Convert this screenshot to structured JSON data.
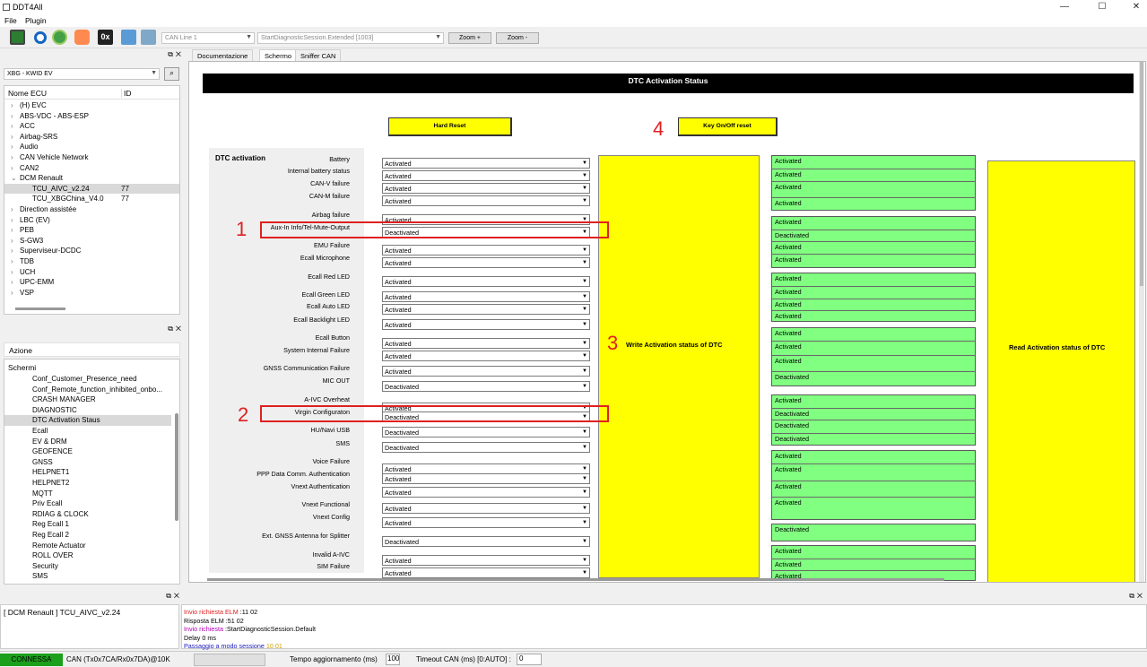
{
  "window": {
    "title": "DDT4All",
    "min": "—",
    "max": "☐",
    "close": "✕"
  },
  "menu": [
    "File",
    "Plugin"
  ],
  "toolbar": {
    "can_line": "CAN Line 1",
    "session": "StartDiagnosticSession.Extended [1003]",
    "zoom_in": "Zoom +",
    "zoom_out": "Zoom -",
    "hex_label": "0x"
  },
  "vehicle": {
    "selected": "XBG - KWID EV",
    "search_icon": "search-icon"
  },
  "ecu_tree": {
    "col_name": "Nome ECU",
    "col_id": "ID",
    "items": [
      {
        "label": "(H) EVC",
        "id": "",
        "level": 0,
        "exp": ">"
      },
      {
        "label": "ABS-VDC - ABS-ESP",
        "id": "",
        "level": 0,
        "exp": ">"
      },
      {
        "label": "ACC",
        "id": "",
        "level": 0,
        "exp": ">"
      },
      {
        "label": "Airbag-SRS",
        "id": "",
        "level": 0,
        "exp": ">"
      },
      {
        "label": "Audio",
        "id": "",
        "level": 0,
        "exp": ">"
      },
      {
        "label": "CAN Vehicle Network",
        "id": "",
        "level": 0,
        "exp": ">"
      },
      {
        "label": "CAN2",
        "id": "",
        "level": 0,
        "exp": ">"
      },
      {
        "label": "DCM Renault",
        "id": "",
        "level": 0,
        "exp": "v"
      },
      {
        "label": "TCU_AIVC_v2.24",
        "id": "77",
        "level": 1,
        "exp": "",
        "selected": true
      },
      {
        "label": "TCU_XBGChina_V4.0",
        "id": "77",
        "level": 1,
        "exp": ""
      },
      {
        "label": "Direction assistée",
        "id": "",
        "level": 0,
        "exp": ">"
      },
      {
        "label": "LBC (EV)",
        "id": "",
        "level": 0,
        "exp": ">"
      },
      {
        "label": "PEB",
        "id": "",
        "level": 0,
        "exp": ">"
      },
      {
        "label": "S-GW3",
        "id": "",
        "level": 0,
        "exp": ">"
      },
      {
        "label": "Superviseur-DCDC",
        "id": "",
        "level": 0,
        "exp": ">"
      },
      {
        "label": "TDB",
        "id": "",
        "level": 0,
        "exp": ">"
      },
      {
        "label": "UCH",
        "id": "",
        "level": 0,
        "exp": ">"
      },
      {
        "label": "UPC-EMM",
        "id": "",
        "level": 0,
        "exp": ">"
      },
      {
        "label": "VSP",
        "id": "",
        "level": 0,
        "exp": ">"
      }
    ]
  },
  "actions": {
    "title": "Azione"
  },
  "screens": {
    "header": "Schermi",
    "items": [
      "Conf_Customer_Presence_need",
      "Conf_Remote_function_inhibited_onbo...",
      "CRASH MANAGER",
      "DIAGNOSTIC",
      "DTC Activation Staus",
      "Ecall",
      "EV & DRM",
      "GEOFENCE",
      "GNSS",
      "HELPNET1",
      "HELPNET2",
      "MQTT",
      "Priv Ecall",
      "RDIAG & CLOCK",
      "Reg Ecall 1",
      "Reg Ecall 2",
      "Remote Actuator",
      "ROLL OVER",
      "Security",
      "SMS"
    ],
    "selected_index": 4
  },
  "tabs": [
    "Documentazione",
    "Schermo",
    "Sniffer CAN"
  ],
  "screen": {
    "title": "DTC Activation Status",
    "hard_reset": "Hard Reset",
    "key_reset": "Key On/Off reset",
    "section": "DTC activation",
    "write_label": "Write Activation status of DTC",
    "read_label": "Read Activation status of DTC",
    "rows": [
      {
        "label": "Battery",
        "value": "Activated"
      },
      {
        "label": "Internal battery status",
        "value": "Activated"
      },
      {
        "label": "CAN-V failure",
        "value": "Activated"
      },
      {
        "label": "CAN-M failure",
        "value": "Activated"
      },
      {
        "label": "Airbag failure",
        "value": "Activated"
      },
      {
        "label": "Aux-In Info/Tel-Mute-Output",
        "value": "Deactivated"
      },
      {
        "label": "EMU Failure",
        "value": "Activated"
      },
      {
        "label": "Ecall Microphone",
        "value": "Activated"
      },
      {
        "label": "Ecall Red LED",
        "value": "Activated"
      },
      {
        "label": "Ecall Green LED",
        "value": "Activated"
      },
      {
        "label": "Ecall Auto LED",
        "value": "Activated"
      },
      {
        "label": "Ecall Backlight  LED",
        "value": "Activated"
      },
      {
        "label": "Ecall Button",
        "value": "Activated"
      },
      {
        "label": "System Internal Failure",
        "value": "Activated"
      },
      {
        "label": "GNSS Communication Failure",
        "value": "Activated"
      },
      {
        "label": "MIC OUT",
        "value": "Deactivated"
      },
      {
        "label": "A-IVC Overheat",
        "value": "Activated"
      },
      {
        "label": "Virgin Configuraton",
        "value": "Deactivated"
      },
      {
        "label": "HU/Navi USB",
        "value": "Deactivated"
      },
      {
        "label": "SMS",
        "value": "Deactivated"
      },
      {
        "label": "Voice Failure",
        "value": "Activated"
      },
      {
        "label": "PPP Data Comm. Authentication",
        "value": "Activated"
      },
      {
        "label": "Vnext Authentication",
        "value": "Activated"
      },
      {
        "label": "Vnext Functional",
        "value": "Activated"
      },
      {
        "label": "Vnext Config",
        "value": "Activated"
      },
      {
        "label": "Ext. GNSS Antenna for Splitter",
        "value": "Deactivated"
      },
      {
        "label": "Invalid A-IVC",
        "value": "Activated"
      },
      {
        "label": "SIM Failure",
        "value": "Activated"
      }
    ],
    "read_values": [
      [
        "Activated",
        "Activated",
        "Activated",
        "Activated"
      ],
      [
        "Activated",
        "Deactivated",
        "Activated",
        "Activated"
      ],
      [
        "Activated",
        "Activated",
        "Activated",
        "Activated"
      ],
      [
        "Activated",
        "Activated",
        "Activated",
        "Deactivated"
      ],
      [
        "Activated",
        "Deactivated",
        "Deactivated",
        "Deactivated"
      ],
      [
        "Activated",
        "Activated",
        "Activated",
        "Activated"
      ],
      [
        "Deactivated"
      ],
      [
        "Activated",
        "Activated",
        "Activated"
      ]
    ],
    "annotations": [
      "1",
      "2",
      "3",
      "4"
    ]
  },
  "log": {
    "ecu_label": "[ DCM Renault ] TCU_AIVC_v2.24",
    "lines": [
      {
        "k": "Invio richiesta ELM",
        "v": "11 02",
        "kc": "#e02020"
      },
      {
        "k": "Risposta ELM",
        "v": "51 02",
        "kc": "#000"
      },
      {
        "k": "Invio richiesta",
        "v": "StartDiagnosticSession.Default",
        "kc": "#b000b0"
      },
      {
        "k": "Delay 0 ms",
        "v": "",
        "kc": "#000"
      },
      {
        "k": "Passaggio a modo sessione",
        "v": "10 01",
        "kc": "#2020c0"
      }
    ]
  },
  "status": {
    "connected": "CONNESSA",
    "can": "CAN (Tx0x7CA/Rx0x7DA)@10K",
    "refresh_label": "Tempo aggiornamento (ms)",
    "refresh_value": "100",
    "timeout_label": "Timeout CAN (ms) [0:AUTO] :",
    "timeout_value": "0"
  },
  "colors": {
    "green": "#80ff80",
    "yellow": "#ffff00",
    "annot_red": "#e02020",
    "connected_bg": "#1ca01c"
  }
}
